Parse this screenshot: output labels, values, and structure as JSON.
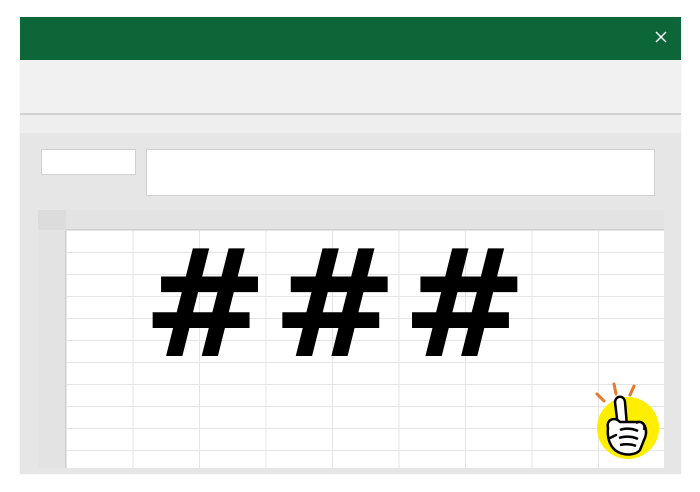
{
  "window": {
    "close_icon": "close-icon",
    "titlebar_color": "#0c6638"
  },
  "formula_bar": {
    "name_box_value": "",
    "formula_value": ""
  },
  "cell": {
    "display_value": "###"
  },
  "badge": {
    "icon": "pointing-finger-icon",
    "background_color": "#ffee00"
  }
}
